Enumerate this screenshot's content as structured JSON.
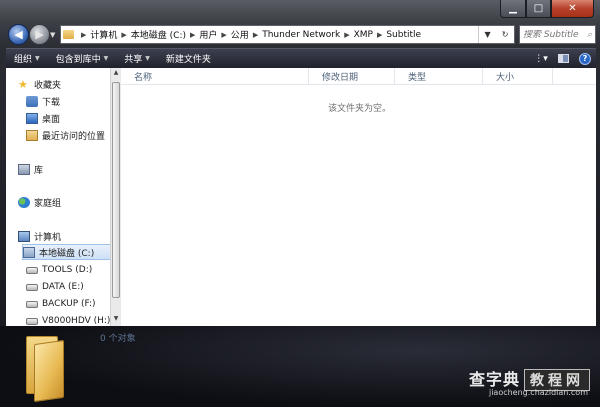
{
  "breadcrumbs": [
    "计算机",
    "本地磁盘 (C:)",
    "用户",
    "公用",
    "Thunder Network",
    "XMP",
    "Subtitle"
  ],
  "search": {
    "placeholder": "搜索 Subtitle"
  },
  "toolbar": {
    "organize": "组织",
    "include_library": "包含到库中",
    "share": "共享",
    "new_folder": "新建文件夹"
  },
  "nav": {
    "favorites": "收藏夹",
    "downloads": "下载",
    "desktop": "桌面",
    "recent": "最近访问的位置",
    "libraries": "库",
    "homegroup": "家庭组",
    "computer": "计算机",
    "drive_c": "本地磁盘 (C:)",
    "drive_d": "TOOLS (D:)",
    "drive_e": "DATA (E:)",
    "drive_f": "BACKUP (F:)",
    "drive_h": "V8000HDV (H:)"
  },
  "columns": {
    "name": "名称",
    "date": "修改日期",
    "type": "类型",
    "size": "大小"
  },
  "empty_message": "该文件夹为空。",
  "details": {
    "item_count": "0 个对象"
  },
  "watermark": {
    "brand": "查字典",
    "box": "教程网",
    "url": "jiaocheng.chazidian.com"
  },
  "colors": {
    "accent": "#3d6bb7",
    "close": "#b6412b"
  }
}
